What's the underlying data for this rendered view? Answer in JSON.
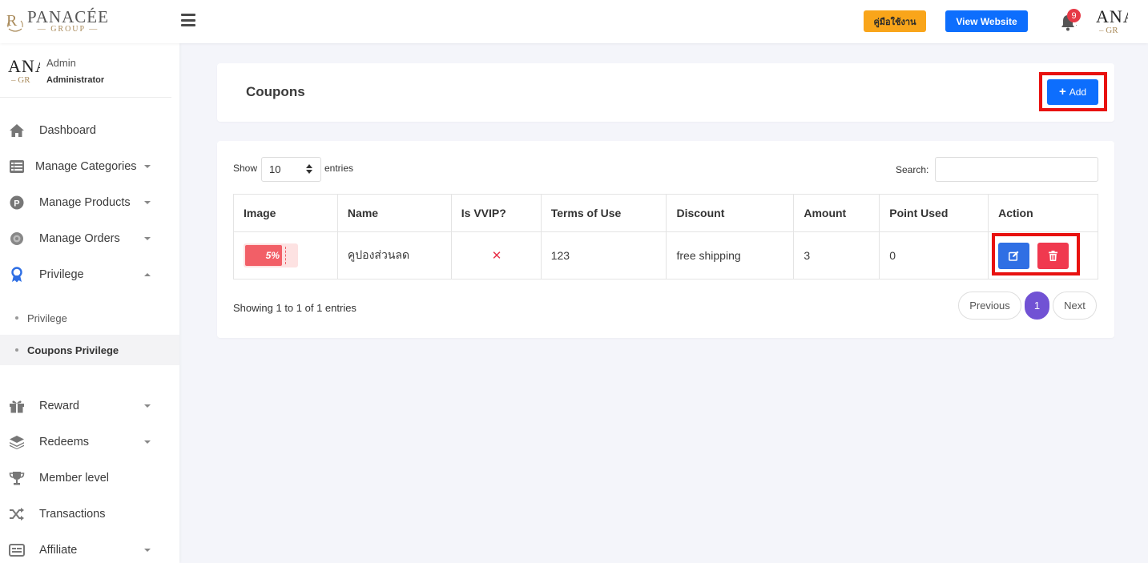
{
  "header": {
    "logo_word": "PANACÉE",
    "logo_sub": "GROUP",
    "manual_button": "คู่มือใช้งาน",
    "website_button": "View Website",
    "notification_count": "9",
    "avatar_line1": "ANA",
    "avatar_line2": "– GR"
  },
  "user": {
    "name": "Admin",
    "role": "Administrator",
    "avatar_line1": "ANA",
    "avatar_line2": "– GR"
  },
  "sidebar": {
    "items": [
      {
        "label": "Dashboard",
        "icon": "home-icon"
      },
      {
        "label": "Manage Categories",
        "icon": "list-icon"
      },
      {
        "label": "Manage Products",
        "icon": "product-icon"
      },
      {
        "label": "Manage Orders",
        "icon": "orders-icon"
      },
      {
        "label": "Privilege",
        "icon": "award-icon"
      },
      {
        "label": "Reward",
        "icon": "gift-icon"
      },
      {
        "label": "Redeems",
        "icon": "layers-icon"
      },
      {
        "label": "Member level",
        "icon": "trophy-icon"
      },
      {
        "label": "Transactions",
        "icon": "shuffle-icon"
      },
      {
        "label": "Affiliate",
        "icon": "id-card-icon"
      }
    ],
    "sub_items": [
      {
        "label": "Privilege"
      },
      {
        "label": "Coupons Privilege"
      }
    ]
  },
  "page": {
    "title": "Coupons",
    "add_button": "Add"
  },
  "table_controls": {
    "show_label": "Show",
    "entries_value": "10",
    "entries_label": "entries",
    "search_label": "Search:",
    "search_value": ""
  },
  "table": {
    "headers": [
      "Image",
      "Name",
      "Is VVIP?",
      "Terms of Use",
      "Discount",
      "Amount",
      "Point Used",
      "Action"
    ],
    "rows": [
      {
        "coupon_text": "5%",
        "name": "คูปองส่วนลด",
        "is_vvip": "✕",
        "terms": "123",
        "discount": "free shipping",
        "amount": "3",
        "point_used": "0"
      }
    ]
  },
  "pagination": {
    "info": "Showing 1 to 1 of 1 entries",
    "previous": "Previous",
    "current_page": "1",
    "next": "Next"
  },
  "colors": {
    "primary": "#0d6efd",
    "warning": "#f9a51a",
    "danger": "#f0394f",
    "page_active": "#7152d4",
    "highlight": "#e8110f"
  }
}
